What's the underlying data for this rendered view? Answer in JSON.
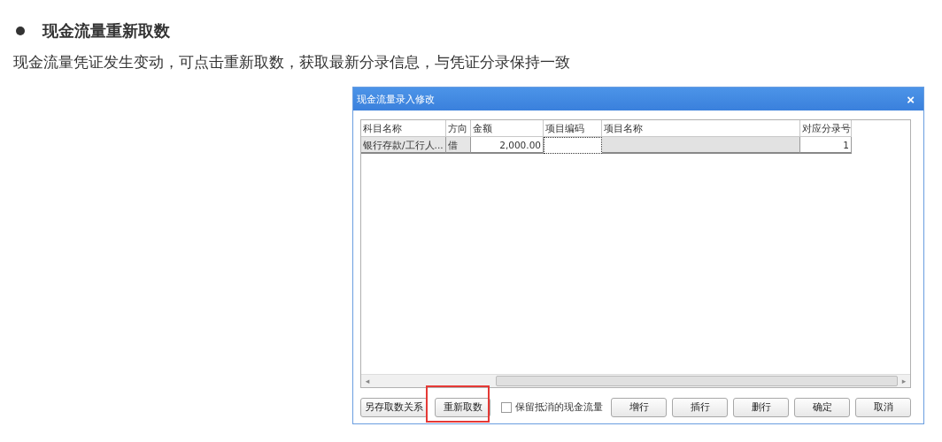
{
  "heading": "现金流量重新取数",
  "description": "现金流量凭证发生变动，可点击重新取数，获取最新分录信息，与凭证分录保持一致",
  "dialog": {
    "title": "现金流量录入修改",
    "close": "×",
    "table": {
      "columns": [
        "科目名称",
        "方向",
        "金额",
        "项目编码",
        "项目名称",
        "对应分录号"
      ],
      "rows": [
        {
          "cells": [
            {
              "kind": "text",
              "text": "银行存款/工行人..."
            },
            {
              "kind": "text",
              "text": "借"
            },
            {
              "kind": "number",
              "text": "2,000.00"
            },
            {
              "kind": "editing"
            },
            {
              "kind": "readonly"
            },
            {
              "kind": "number",
              "text": "1"
            }
          ]
        }
      ]
    },
    "scrollbar_arrows": [
      "◂",
      "▸"
    ],
    "buttons_left": [
      {
        "label": "另存取数关系",
        "highlighted": false
      },
      {
        "label": "重新取数",
        "highlighted": true
      }
    ],
    "checkbox": {
      "label": "保留抵消的现金流量",
      "checked": false
    },
    "buttons_right": [
      "增行",
      "插行",
      "删行",
      "确定",
      "取消"
    ]
  }
}
